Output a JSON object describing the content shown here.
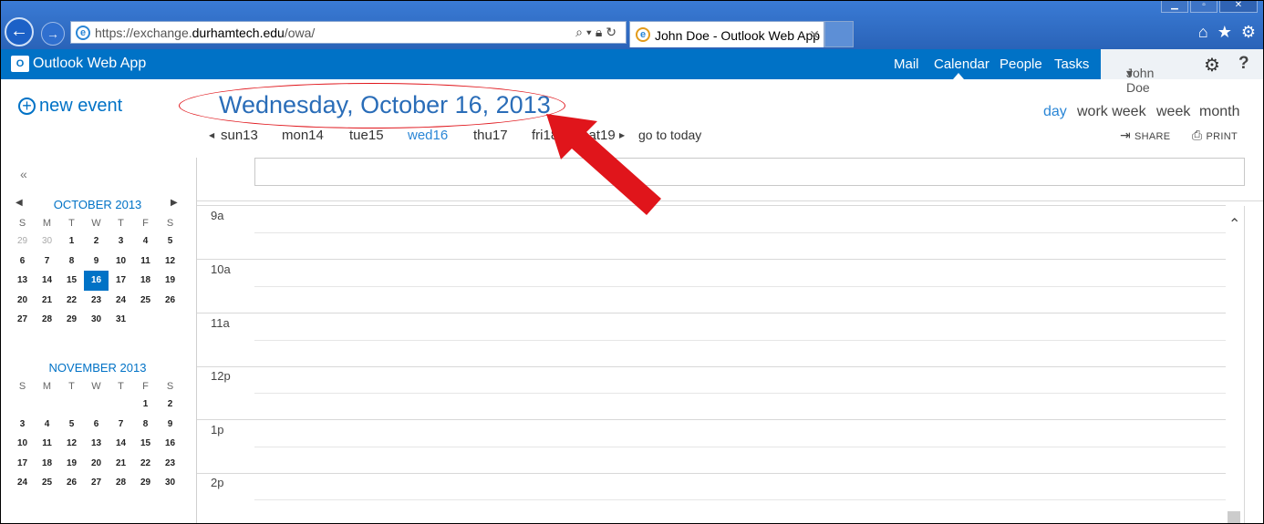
{
  "browser": {
    "url_prefix": "https://",
    "url_domain_pre": "exchange.",
    "url_domain": "durhamtech.edu",
    "url_path": "/owa/",
    "tab_title": "John Doe - Outlook Web App"
  },
  "app": {
    "name": "Outlook Web App",
    "nav": [
      "Mail",
      "Calendar",
      "People",
      "Tasks"
    ],
    "user": "John Doe"
  },
  "new_event": "new event",
  "date_header": "Wednesday, October 16, 2013",
  "day_strip": [
    {
      "label": "sun13"
    },
    {
      "label": "mon14"
    },
    {
      "label": "tue15"
    },
    {
      "label": "wed16"
    },
    {
      "label": "thu17"
    },
    {
      "label": "fri18"
    },
    {
      "label": "sat19"
    }
  ],
  "go_to_today": "go to today",
  "views": [
    "day",
    "work week",
    "week",
    "month"
  ],
  "actions": {
    "share": "SHARE",
    "print": "PRINT"
  },
  "october": {
    "title": "OCTOBER 2013",
    "dow": [
      "S",
      "M",
      "T",
      "W",
      "T",
      "F",
      "S"
    ],
    "weeks": [
      [
        "29",
        "30",
        "1",
        "2",
        "3",
        "4",
        "5"
      ],
      [
        "6",
        "7",
        "8",
        "9",
        "10",
        "11",
        "12"
      ],
      [
        "13",
        "14",
        "15",
        "16",
        "17",
        "18",
        "19"
      ],
      [
        "20",
        "21",
        "22",
        "23",
        "24",
        "25",
        "26"
      ],
      [
        "27",
        "28",
        "29",
        "30",
        "31",
        "",
        ""
      ]
    ]
  },
  "november": {
    "title": "NOVEMBER 2013",
    "dow": [
      "S",
      "M",
      "T",
      "W",
      "T",
      "F",
      "S"
    ],
    "weeks": [
      [
        "",
        "",
        "",
        "",
        "",
        "1",
        "2"
      ],
      [
        "3",
        "4",
        "5",
        "6",
        "7",
        "8",
        "9"
      ],
      [
        "10",
        "11",
        "12",
        "13",
        "14",
        "15",
        "16"
      ],
      [
        "17",
        "18",
        "19",
        "20",
        "21",
        "22",
        "23"
      ],
      [
        "24",
        "25",
        "26",
        "27",
        "28",
        "29",
        "30"
      ]
    ]
  },
  "hours": [
    "9a",
    "10a",
    "11a",
    "12p",
    "1p",
    "2p"
  ],
  "colors": {
    "accent": "#0072c6",
    "annotation": "#e0151b"
  }
}
